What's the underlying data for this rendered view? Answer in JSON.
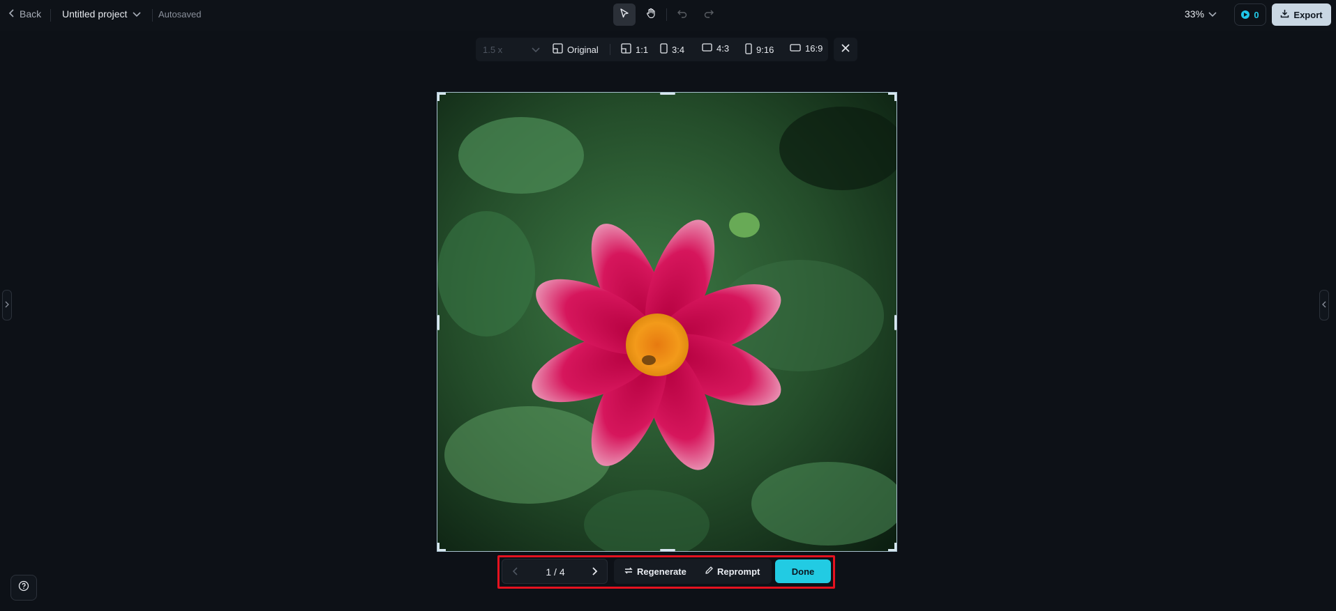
{
  "header": {
    "back_label": "Back",
    "project_title": "Untitled project",
    "save_status": "Autosaved",
    "zoom_level": "33%",
    "credits_count": "0",
    "export_label": "Export"
  },
  "ratio_bar": {
    "scale_value": "1.5 x",
    "options": [
      "Original",
      "1:1",
      "3:4",
      "4:3",
      "9:16",
      "16:9"
    ]
  },
  "pager": {
    "count": "1 / 4"
  },
  "actions": {
    "regenerate_label": "Regenerate",
    "reprompt_label": "Reprompt",
    "done_label": "Done"
  },
  "colors": {
    "accent": "#22cbe3",
    "highlight_border": "#e5121f",
    "background": "#0d1117"
  },
  "icons": [
    "chevron-left-icon",
    "chevron-down-icon",
    "pointer-icon",
    "hand-icon",
    "undo-icon",
    "redo-icon",
    "download-icon",
    "close-icon",
    "regenerate-icon",
    "pencil-icon",
    "help-icon"
  ]
}
